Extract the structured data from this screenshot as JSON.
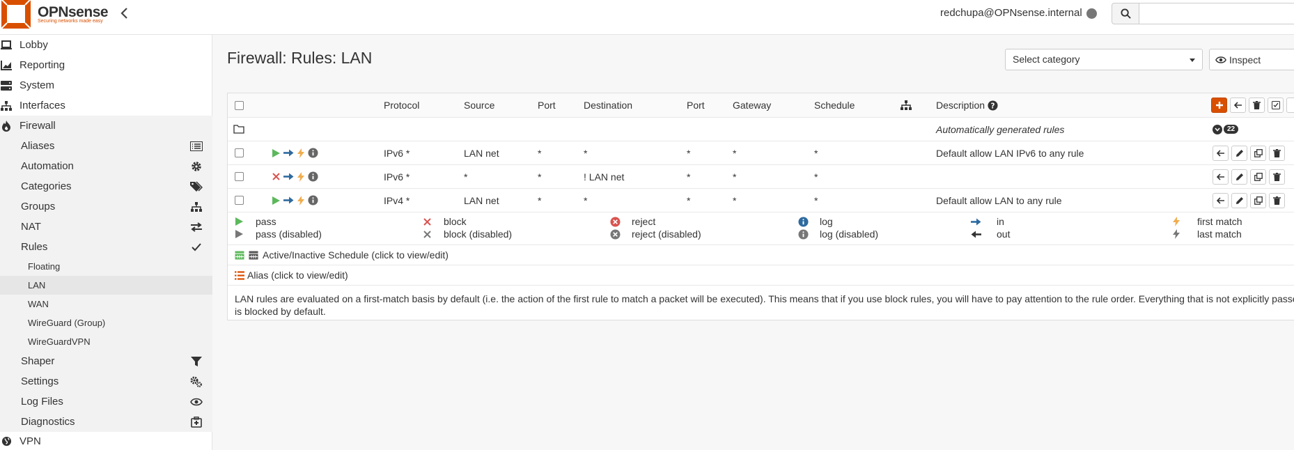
{
  "header": {
    "brand": "OPNsense",
    "tagline": "Securing networks made easy",
    "username": "redchupa@OPNsense.internal",
    "search_placeholder": ""
  },
  "sidebar": {
    "items": [
      {
        "label": "Lobby",
        "icon": "laptop-icon"
      },
      {
        "label": "Reporting",
        "icon": "chart-icon"
      },
      {
        "label": "System",
        "icon": "server-icon"
      },
      {
        "label": "Interfaces",
        "icon": "sitemap-icon"
      },
      {
        "label": "Firewall",
        "icon": "fire-icon"
      }
    ],
    "firewall_sub": [
      {
        "label": "Aliases",
        "icon": "list-icon"
      },
      {
        "label": "Automation",
        "icon": "gear-icon"
      },
      {
        "label": "Categories",
        "icon": "tags-icon"
      },
      {
        "label": "Groups",
        "icon": "sitemap-icon"
      },
      {
        "label": "NAT",
        "icon": "exchange-icon"
      },
      {
        "label": "Rules",
        "icon": "check-icon"
      }
    ],
    "rules_sub": [
      {
        "label": "Floating"
      },
      {
        "label": "LAN"
      },
      {
        "label": "WAN"
      },
      {
        "label": "WireGuard (Group)"
      },
      {
        "label": "WireGuardVPN"
      }
    ],
    "firewall_sub2": [
      {
        "label": "Shaper",
        "icon": "filter-icon"
      },
      {
        "label": "Settings",
        "icon": "cogs-icon"
      },
      {
        "label": "Log Files",
        "icon": "eye-icon"
      },
      {
        "label": "Diagnostics",
        "icon": "medkit-icon"
      }
    ],
    "vpn": {
      "label": "VPN",
      "icon": "globe-icon"
    }
  },
  "main": {
    "title": "Firewall: Rules: LAN",
    "category_placeholder": "Select category",
    "inspect_label": "Inspect",
    "columns": {
      "protocol": "Protocol",
      "source": "Source",
      "port": "Port",
      "destination": "Destination",
      "port2": "Port",
      "gateway": "Gateway",
      "schedule": "Schedule",
      "description": "Description"
    },
    "auto_rules": {
      "label": "Automatically generated rules",
      "count": "22"
    },
    "rules": [
      {
        "action": "pass",
        "protocol": "IPv6 *",
        "source": "LAN net",
        "port": "*",
        "destination": "*",
        "dport": "*",
        "gateway": "*",
        "schedule": "*",
        "description": "Default allow LAN IPv6 to any rule"
      },
      {
        "action": "block",
        "protocol": "IPv6 *",
        "source": "*",
        "port": "*",
        "destination": "! LAN net",
        "dport": "*",
        "gateway": "*",
        "schedule": "*",
        "description": ""
      },
      {
        "action": "pass",
        "protocol": "IPv4 *",
        "source": "LAN net",
        "port": "*",
        "destination": "*",
        "dport": "*",
        "gateway": "*",
        "schedule": "*",
        "description": "Default allow LAN to any rule"
      }
    ],
    "legend": {
      "pass": "pass",
      "pass_disabled": "pass (disabled)",
      "block": "block",
      "block_disabled": "block (disabled)",
      "reject": "reject",
      "reject_disabled": "reject (disabled)",
      "log": "log",
      "log_disabled": "log (disabled)",
      "in": "in",
      "out": "out",
      "first_match": "first match",
      "last_match": "last match"
    },
    "schedule_note": "Active/Inactive Schedule (click to view/edit)",
    "alias_note": "Alias (click to view/edit)",
    "notice_line1": "LAN rules are evaluated on a first-match basis by default (i.e. the action of the first rule to match a packet will be executed). This means that if you use block rules, you will have to pay attention to the rule order. Everything that is not explicitly passed",
    "notice_line2": "is blocked by default."
  },
  "colors": {
    "accent": "#d94f00",
    "pass": "#5cb85c",
    "block": "#d9534f",
    "in": "#2d6a9f",
    "match": "#f0ad4e"
  }
}
